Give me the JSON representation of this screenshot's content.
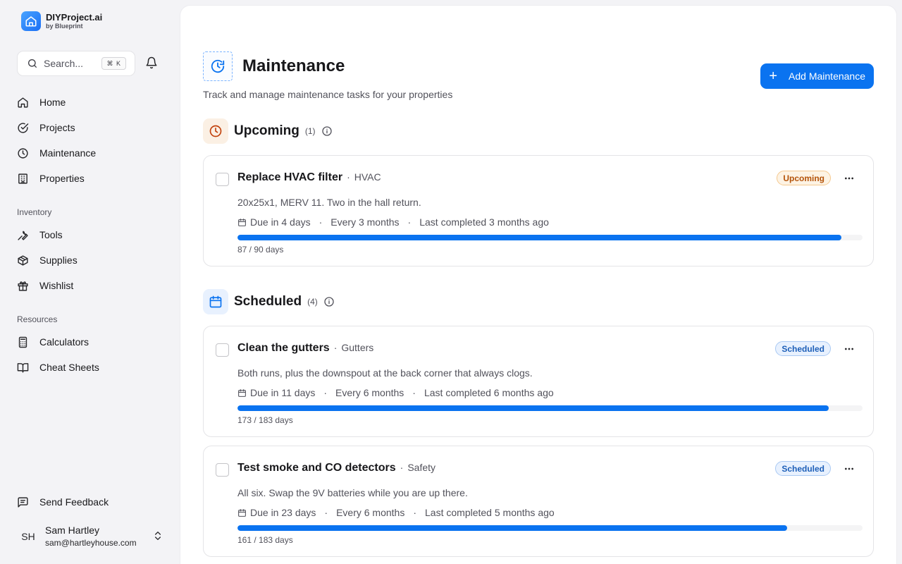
{
  "brand": {
    "name": "DIYProject.ai",
    "sub": "by Blueprint"
  },
  "search": {
    "placeholder": "Search...",
    "shortcut": "⌘ K"
  },
  "nav": {
    "main": [
      {
        "label": "Home",
        "icon": "home-icon"
      },
      {
        "label": "Projects",
        "icon": "check-circle-icon"
      },
      {
        "label": "Maintenance",
        "icon": "clock-icon"
      },
      {
        "label": "Properties",
        "icon": "building-icon"
      }
    ],
    "inventory_heading": "Inventory",
    "inventory": [
      {
        "label": "Tools",
        "icon": "wrench-icon"
      },
      {
        "label": "Supplies",
        "icon": "box-icon"
      },
      {
        "label": "Wishlist",
        "icon": "gift-icon"
      }
    ],
    "resources_heading": "Resources",
    "resources": [
      {
        "label": "Calculators",
        "icon": "calculator-icon"
      },
      {
        "label": "Cheat Sheets",
        "icon": "book-icon"
      }
    ],
    "feedback": "Send Feedback"
  },
  "user": {
    "initials": "SH",
    "name": "Sam Hartley",
    "email": "sam@hartleyhouse.com"
  },
  "page": {
    "title": "Maintenance",
    "subtitle": "Track and manage maintenance tasks for your properties",
    "add_label": "Add Maintenance"
  },
  "sections": {
    "upcoming": {
      "title": "Upcoming",
      "count": "(1)"
    },
    "scheduled": {
      "title": "Scheduled",
      "count": "(4)"
    }
  },
  "tasks": [
    {
      "name": "Replace HVAC filter",
      "category": "HVAC",
      "status": "Upcoming",
      "description": "20x25x1, MERV 11. Two in the hall return.",
      "due": "Due in 4 days",
      "frequency": "Every 3 months",
      "last": "Last completed 3 months ago",
      "progress": 0.9667,
      "progress_label": "87 / 90 days"
    },
    {
      "name": "Clean the gutters",
      "category": "Gutters",
      "status": "Scheduled",
      "description": "Both runs, plus the downspout at the back corner that always clogs.",
      "due": "Due in 11 days",
      "frequency": "Every 6 months",
      "last": "Last completed 6 months ago",
      "progress": 0.9454,
      "progress_label": "173 / 183 days"
    },
    {
      "name": "Test smoke and CO detectors",
      "category": "Safety",
      "status": "Scheduled",
      "description": "All six. Swap the 9V batteries while you are up there.",
      "due": "Due in 23 days",
      "frequency": "Every 6 months",
      "last": "Last completed 5 months ago",
      "progress": 0.8798,
      "progress_label": "161 / 183 days"
    }
  ],
  "colors": {
    "accent": "#0a73f0",
    "upcoming": "#b45309",
    "scheduled": "#1d5fb8"
  }
}
